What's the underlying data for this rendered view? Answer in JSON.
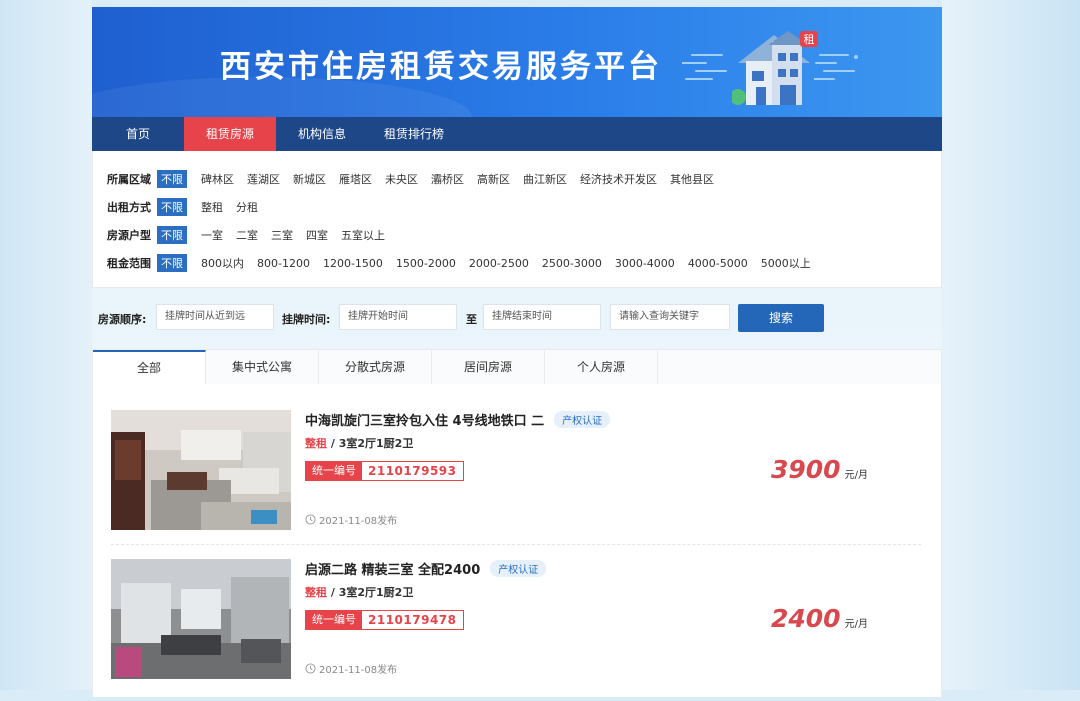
{
  "header": {
    "title": "西安市住房租赁交易服务平台",
    "house_badge": "租"
  },
  "nav": {
    "items": [
      "首页",
      "租赁房源",
      "机构信息",
      "租赁排行榜"
    ],
    "active_index": 1
  },
  "filters": {
    "region": {
      "label": "所属区域",
      "options": [
        "不限",
        "碑林区",
        "莲湖区",
        "新城区",
        "雁塔区",
        "未央区",
        "灞桥区",
        "高新区",
        "曲江新区",
        "经济技术开发区",
        "其他县区"
      ]
    },
    "rent_mode": {
      "label": "出租方式",
      "options": [
        "不限",
        "整租",
        "分租"
      ]
    },
    "layout": {
      "label": "房源户型",
      "options": [
        "不限",
        "一室",
        "二室",
        "三室",
        "四室",
        "五室以上"
      ]
    },
    "rent_range": {
      "label": "租金范围",
      "options": [
        "不限",
        "800以内",
        "800-1200",
        "1200-1500",
        "1500-2000",
        "2000-2500",
        "2500-3000",
        "3000-4000",
        "4000-5000",
        "5000以上"
      ]
    }
  },
  "search": {
    "order_label": "房源顺序:",
    "order_value": "挂牌时间从近到远",
    "time_label": "挂牌时间:",
    "start_placeholder": "挂牌开始时间",
    "to_label": "至",
    "end_placeholder": "挂牌结束时间",
    "keyword_placeholder": "请输入查询关键字",
    "button_label": "搜索"
  },
  "tabs": {
    "items": [
      "全部",
      "集中式公寓",
      "分散式房源",
      "居间房源",
      "个人房源"
    ],
    "active_index": 0
  },
  "listings": [
    {
      "title": "中海凯旋门三室拎包入住 4号线地铁口 二",
      "badge": "产权认证",
      "rent_type": "整租",
      "layout": "3室2厅1厨2卫",
      "code_label": "统一编号",
      "code": "2110179593",
      "date": "2021-11-08发布",
      "price": "3900",
      "unit": "元/月"
    },
    {
      "title": "启源二路 精装三室 全配2400",
      "badge": "产权认证",
      "rent_type": "整租",
      "layout": "3室2厅1厨2卫",
      "code_label": "统一编号",
      "code": "2110179478",
      "date": "2021-11-08发布",
      "price": "2400",
      "unit": "元/月"
    }
  ],
  "colors": {
    "banner": "#2a7ce8",
    "nav": "#1e4788",
    "accent_red": "#e6434a",
    "accent_blue": "#2467b8"
  },
  "icons": {
    "clock": "clock-icon",
    "house": "house-illustration"
  }
}
